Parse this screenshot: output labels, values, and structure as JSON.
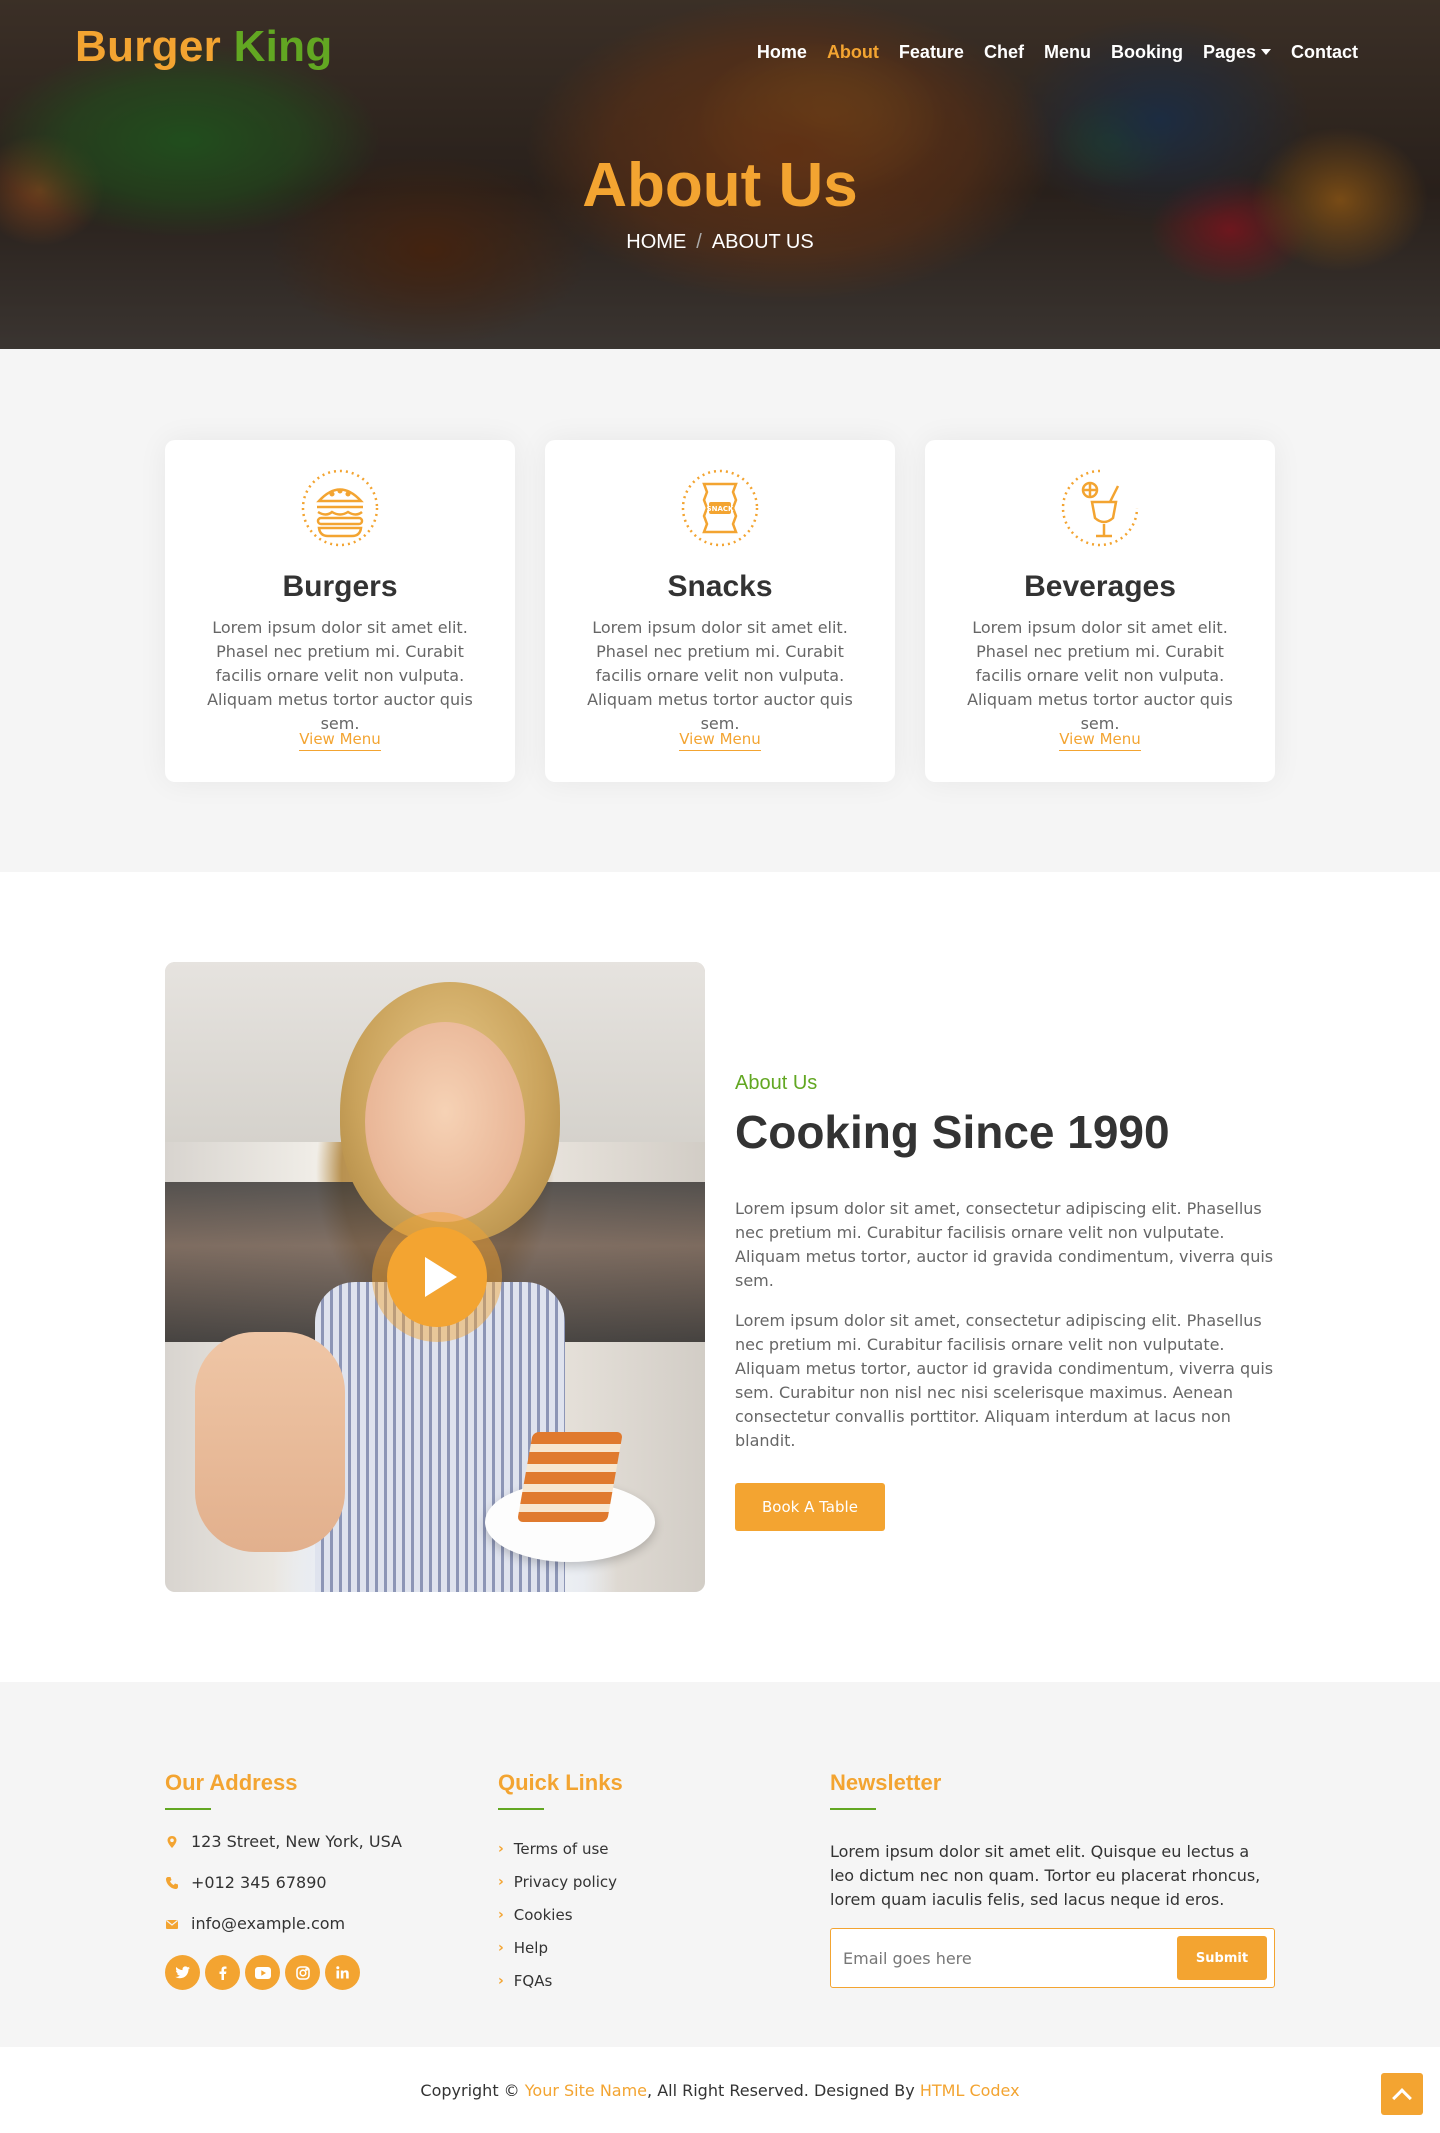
{
  "brand": {
    "part1": "Burger",
    "part2": "King"
  },
  "nav": {
    "items": [
      "Home",
      "About",
      "Feature",
      "Chef",
      "Menu",
      "Booking",
      "Pages",
      "Contact"
    ],
    "active": "About"
  },
  "hero": {
    "title": "About Us",
    "crumb_home": "HOME",
    "crumb_sep": "/",
    "crumb_current": "ABOUT US"
  },
  "services": [
    {
      "title": "Burgers",
      "icon": "burger-icon",
      "text": "Lorem ipsum dolor sit amet elit. Phasel nec pretium mi. Curabit facilis ornare velit non vulputa. Aliquam metus tortor auctor quis sem.",
      "link": "View Menu"
    },
    {
      "title": "Snacks",
      "icon": "snack-icon",
      "icon_label": "SNACK",
      "text": "Lorem ipsum dolor sit amet elit. Phasel nec pretium mi. Curabit facilis ornare velit non vulputa. Aliquam metus tortor auctor quis sem.",
      "link": "View Menu"
    },
    {
      "title": "Beverages",
      "icon": "beverage-icon",
      "text": "Lorem ipsum dolor sit amet elit. Phasel nec pretium mi. Curabit facilis ornare velit non vulputa. Aliquam metus tortor auctor quis sem.",
      "link": "View Menu"
    }
  ],
  "about": {
    "tag": "About Us",
    "title": "Cooking Since 1990",
    "p1": "Lorem ipsum dolor sit amet, consectetur adipiscing elit. Phasellus nec pretium mi. Curabitur facilisis ornare velit non vulputate. Aliquam metus tortor, auctor id gravida condimentum, viverra quis sem.",
    "p2": "Lorem ipsum dolor sit amet, consectetur adipiscing elit. Phasellus nec pretium mi. Curabitur facilisis ornare velit non vulputate. Aliquam metus tortor, auctor id gravida condimentum, viverra quis sem. Curabitur non nisl nec nisi scelerisque maximus. Aenean consectetur convallis porttitor. Aliquam interdum at lacus non blandit.",
    "button": "Book A Table"
  },
  "footer": {
    "address": {
      "title": "Our Address",
      "street": "123 Street, New York, USA",
      "phone": "+012 345 67890",
      "email": "info@example.com",
      "socials": [
        "twitter-icon",
        "facebook-icon",
        "youtube-icon",
        "instagram-icon",
        "linkedin-icon"
      ]
    },
    "quick": {
      "title": "Quick Links",
      "links": [
        "Terms of use",
        "Privacy policy",
        "Cookies",
        "Help",
        "FQAs"
      ]
    },
    "newsletter": {
      "title": "Newsletter",
      "text": "Lorem ipsum dolor sit amet elit. Quisque eu lectus a leo dictum nec non quam. Tortor eu placerat rhoncus, lorem quam iaculis felis, sed lacus neque id eros.",
      "placeholder": "Email goes here",
      "button": "Submit"
    }
  },
  "copyright": {
    "prefix": "Copyright © ",
    "site": "Your Site Name",
    "middle": ", All Right Reserved. Designed By ",
    "designer": "HTML Codex"
  },
  "colors": {
    "accent": "#f3a431",
    "green": "#62a722",
    "dark": "#333333"
  }
}
